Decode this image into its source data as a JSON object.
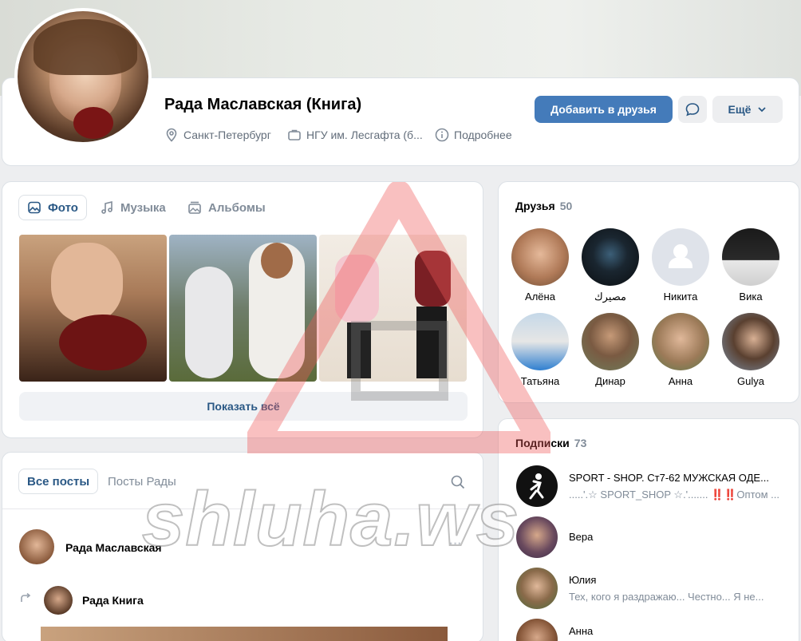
{
  "profile": {
    "name": "Рада Маславская (Книга)",
    "city": "Санкт-Петербург",
    "education": "НГУ им. Лесгафта (б...",
    "more_info": "Подробнее"
  },
  "actions": {
    "add_friend": "Добавить в друзья",
    "more": "Ещё"
  },
  "photos_tabs": [
    "Фото",
    "Музыка",
    "Альбомы"
  ],
  "show_all": "Показать всё",
  "posts": {
    "tabs": [
      "Все посты",
      "Посты Рады"
    ],
    "author": "Рада Маславская",
    "repost_author": "Рада Книга",
    "more": "···"
  },
  "friends": {
    "title": "Друзья",
    "count": "50",
    "items": [
      "Алёна",
      "مصيرك",
      "Никита",
      "Вика",
      "Татьяна",
      "Динар",
      "Анна",
      "Gulya"
    ]
  },
  "subscriptions": {
    "title": "Подписки",
    "count": "73",
    "items": [
      {
        "title": "SPORT - SHOP. Ст7-62 МУЖСКАЯ ОДЕ...",
        "desc": ".....'.☆ SPORT_SHOP ☆.'....... ‼️‼️Оптом ..."
      },
      {
        "title": "Вера",
        "desc": ""
      },
      {
        "title": "Юлия",
        "desc": "Тех, кого я раздражаю... Честно... Я не..."
      },
      {
        "title": "Анна",
        "desc": ""
      }
    ]
  },
  "watermark": {
    "text": "shluha.ws"
  },
  "colors": {
    "accent": "#447bba",
    "link": "#2a5885",
    "muted": "#818c99"
  }
}
